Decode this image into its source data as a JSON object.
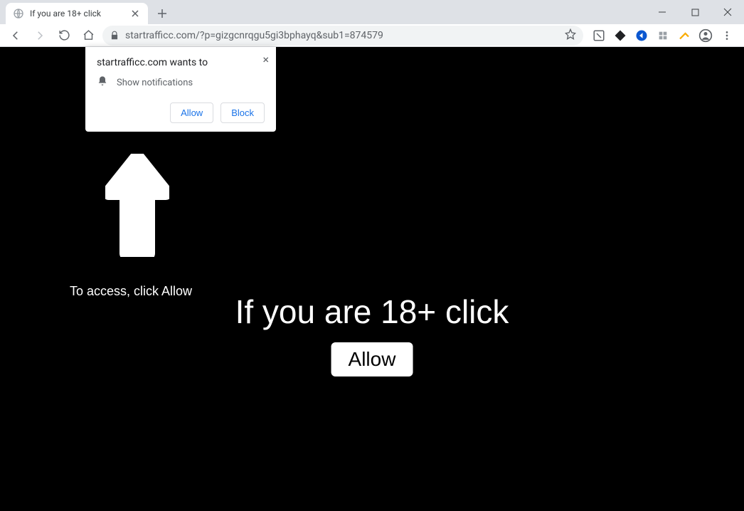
{
  "window": {
    "tab_title": "If you are 18+ click"
  },
  "address_bar": {
    "url": "startrafficc.com/?p=gizgcnrqgu5gi3bphayq&sub1=874579"
  },
  "permission_prompt": {
    "origin_text": "startrafficc.com wants to",
    "permission_label": "Show notifications",
    "allow_label": "Allow",
    "block_label": "Block"
  },
  "page": {
    "hint_text": "To access, click Allow",
    "heading_text": "If you are 18+ click",
    "allow_button_label": "Allow"
  }
}
